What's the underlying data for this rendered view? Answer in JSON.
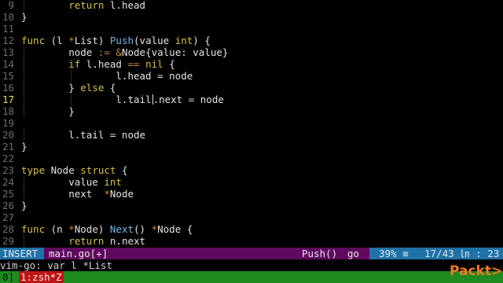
{
  "editor": {
    "lines": [
      {
        "n": "9",
        "text": "        return l.head"
      },
      {
        "n": "10",
        "text": "}"
      },
      {
        "n": "11",
        "text": ""
      },
      {
        "n": "12",
        "text": "func (l *List) Push(value int) {"
      },
      {
        "n": "13",
        "text": "        node := &Node{value: value}"
      },
      {
        "n": "14",
        "text": "        if l.head == nil {"
      },
      {
        "n": "15",
        "text": "                l.head = node"
      },
      {
        "n": "16",
        "text": "        } else {"
      },
      {
        "n": "17",
        "text": "                l.tail.next = node"
      },
      {
        "n": "18",
        "text": "        }"
      },
      {
        "n": "19",
        "text": ""
      },
      {
        "n": "20",
        "text": "        l.tail = node"
      },
      {
        "n": "21",
        "text": "}"
      },
      {
        "n": "22",
        "text": ""
      },
      {
        "n": "23",
        "text": "type Node struct {"
      },
      {
        "n": "24",
        "text": "        value int"
      },
      {
        "n": "25",
        "text": "        next  *Node"
      },
      {
        "n": "26",
        "text": "}"
      },
      {
        "n": "27",
        "text": ""
      },
      {
        "n": "28",
        "text": "func (n *Node) Next() *Node {"
      },
      {
        "n": "29",
        "text": "        return n.next"
      }
    ],
    "current_line": "17"
  },
  "statusbar": {
    "mode": "INSERT",
    "filename": "main.go[+]",
    "function": "Push()",
    "filetype": "go",
    "percent": "39% ≡",
    "line_col": "17/43 ㏑ : 23"
  },
  "cmdline": {
    "text": "vim-go: var l *List"
  },
  "tmux": {
    "session": "0]",
    "window": "1:zsh*Z"
  },
  "logo": {
    "text": "Packt>"
  },
  "colors": {
    "keyword": "#d8c04a",
    "function": "#73b6e8",
    "statusbar": "#5f0a5f",
    "mode_bg": "#1f72a8",
    "tmux_bg": "#1f8a1f",
    "tmux_window_bg": "#c01414",
    "logo": "#f07a22"
  }
}
